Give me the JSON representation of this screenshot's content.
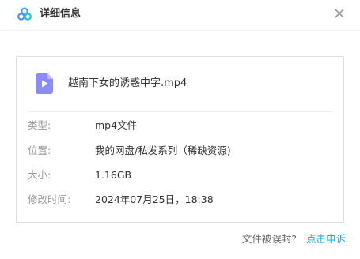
{
  "header": {
    "title": "详细信息",
    "logo_icon": "cloud-logo-icon",
    "close_icon": "close-icon"
  },
  "file": {
    "icon": "video-file-icon",
    "name": "越南下女的诱惑中字.mp4",
    "icon_color": "#8b8cf8"
  },
  "details": [
    {
      "label": "类型:",
      "value": "mp4文件"
    },
    {
      "label": "位置:",
      "value": "我的网盘/私发系列（稀缺资源)"
    },
    {
      "label": "大小:",
      "value": "1.16GB"
    },
    {
      "label": "修改时间:",
      "value": "2024年07月25日，18:38"
    }
  ],
  "footer": {
    "question": "文件被误封?",
    "appeal_link": "点击申诉"
  },
  "colors": {
    "accent": "#06a7ff",
    "label": "#999999",
    "text": "#333333"
  }
}
